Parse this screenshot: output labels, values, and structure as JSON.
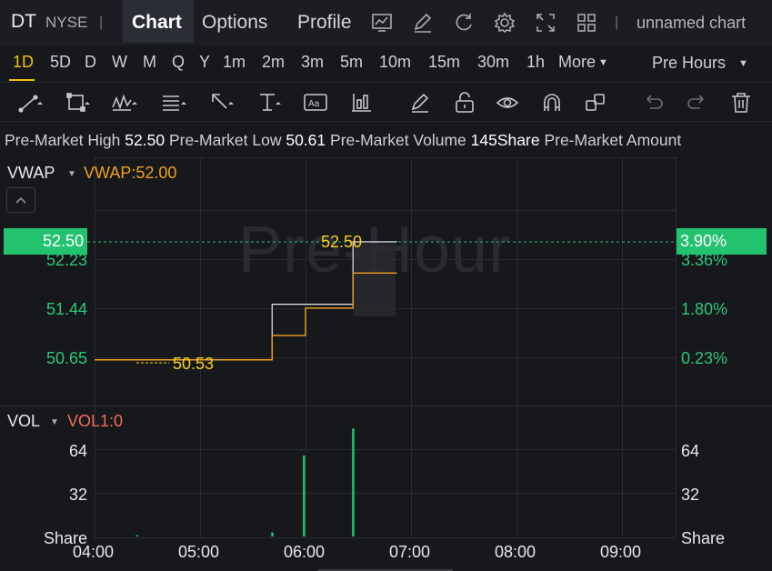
{
  "header": {
    "symbol": "DT",
    "exchange": "NYSE",
    "separator": "|",
    "tabs": [
      "Chart",
      "Options",
      "Profile"
    ],
    "active_tab": "Chart",
    "toolbar_icons": [
      "chart-type-icon",
      "indicator-pen-icon",
      "refresh-icon",
      "settings-gear-icon",
      "fullscreen-icon",
      "layout-grid-icon"
    ],
    "chart_name": "unnamed chart"
  },
  "intervals": {
    "items": [
      "1D",
      "5D",
      "D",
      "W",
      "M",
      "Q",
      "Y",
      "1m",
      "2m",
      "3m",
      "5m",
      "10m",
      "15m",
      "30m",
      "1h",
      "More"
    ],
    "active": "1D",
    "session": "Pre Hours"
  },
  "drawing_tools": [
    "trend-line-icon",
    "rectangle-icon",
    "pattern-icon",
    "fib-lines-icon",
    "arrow-icon",
    "text-tool-icon",
    "annotation-icon",
    "price-range-icon",
    "pen-icon",
    "lock-icon",
    "eye-icon",
    "magnet-icon",
    "clone-icon",
    "undo-icon",
    "redo-icon",
    "trash-icon"
  ],
  "premarket": {
    "high_label": "Pre-Market High",
    "high_value": "52.50",
    "low_label": "Pre-Market Low",
    "low_value": "50.61",
    "volume_label": "Pre-Market Volume",
    "volume_value": "145Share",
    "amount_label": "Pre-Market Amount"
  },
  "main_chart": {
    "indicator_name": "VWAP",
    "indicator_value": "VWAP:52.00",
    "watermark": "Pre-Hour",
    "current_price": "52.50",
    "current_pct": "3.90%",
    "high_marker": "52.50",
    "low_marker": "50.53",
    "y_left_ticks": [
      "52.23",
      "51.44",
      "50.65"
    ],
    "y_right_ticks": [
      "3.36%",
      "1.80%",
      "0.23%"
    ],
    "colors": {
      "up": "#23c26f",
      "vwap": "#f0a020",
      "price": "#e8e9ec",
      "marker": "#f5d020"
    }
  },
  "volume_panel": {
    "indicator_name": "VOL",
    "indicator_value": "VOL1:0",
    "y_ticks": [
      "64",
      "32"
    ],
    "unit": "Share"
  },
  "time_axis": [
    "04:00",
    "05:00",
    "06:00",
    "07:00",
    "08:00",
    "09:00"
  ],
  "chart_data": {
    "type": "line",
    "x": [
      "04:00",
      "04:24",
      "05:40",
      "05:41",
      "06:00",
      "06:27",
      "06:52"
    ],
    "series": [
      {
        "name": "Price",
        "values": [
          50.61,
          50.61,
          50.61,
          51.5,
          51.5,
          52.5,
          52.5
        ]
      },
      {
        "name": "VWAP",
        "values": [
          50.61,
          50.61,
          50.61,
          51.0,
          51.44,
          52.0,
          52.0
        ]
      }
    ],
    "volume": {
      "x": [
        "04:24",
        "05:41",
        "05:59",
        "06:27"
      ],
      "values": [
        1,
        3,
        60,
        80
      ]
    },
    "ylim": [
      50.4,
      52.6
    ],
    "vol_ylim": [
      0,
      96
    ],
    "grid": true
  }
}
